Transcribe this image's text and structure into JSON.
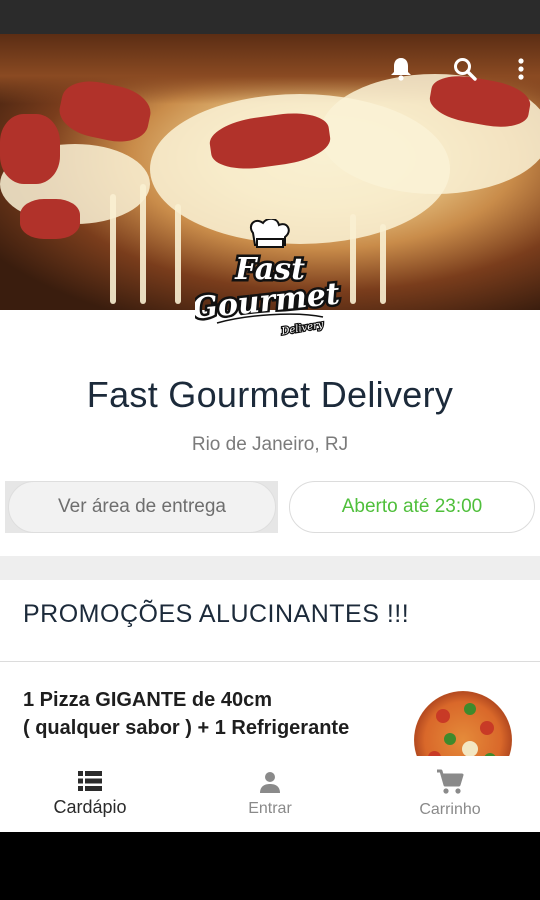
{
  "hero": {
    "icons": [
      "bell-icon",
      "search-icon",
      "more-vert-icon"
    ]
  },
  "logo": {
    "text_line1": "Fast",
    "text_line2": "Gourmet",
    "text_line3": "Delivery"
  },
  "store": {
    "name": "Fast Gourmet Delivery",
    "city": "Rio de Janeiro, RJ"
  },
  "actions": {
    "delivery_area_label": "Ver área de entrega",
    "open_until_label": "Aberto até 23:00"
  },
  "promotions": {
    "title": "PROMOÇÕES ALUCINANTES !!!",
    "items": [
      {
        "line1": "1 Pizza GIGANTE de 40cm",
        "line2": "( qualquer sabor ) + 1 Refrigerante"
      }
    ]
  },
  "bottom_nav": {
    "items": [
      {
        "label": "Cardápio",
        "icon": "list-icon",
        "active": true
      },
      {
        "label": "Entrar",
        "icon": "person-icon",
        "active": false
      },
      {
        "label": "Carrinho",
        "icon": "cart-icon",
        "active": false
      }
    ]
  },
  "colors": {
    "primary_text": "#1c2a3a",
    "open_green": "#4fbf3b",
    "muted_text": "#7b7b7b"
  }
}
